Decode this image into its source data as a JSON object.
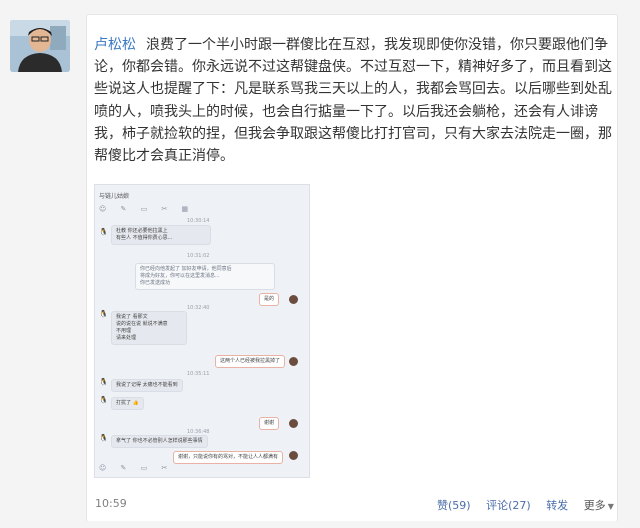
{
  "post": {
    "author": "卢松松",
    "body": "浪费了一个半小时跟一群傻比在互怼，我发现即使你没错，你只要跟他们争论，你都会错。你永远说不过这帮键盘侠。不过互怼一下，精神好多了，而且看到这些说这人也提醒了下：凡是联系骂我三天以上的人，我都会骂回去。以后哪些到处乱喷的人，喷我头上的时候，也会自行掂量一下了。以后我还会躺枪，还会有人诽谤我，柿子就捡软的捏，但我会争取跟这帮傻比打打官司，只有大家去法院走一圈，那帮傻比才会真正消停。",
    "time": "10:59"
  },
  "screenshot": {
    "title": "与链儿姑娘",
    "toolbar_icons": "☺ ✎ ▭ ✂ ▦",
    "bottom_icons": "☺ ✎ ▭ ✂",
    "timestamps": [
      "10:30:14",
      "10:31:02",
      "10:32:40",
      "10:35:11",
      "10:36:48",
      "10:38:20",
      "10:40:02"
    ],
    "messages": [
      "杜教  你还必要他拉黑上\n有些人  不值得你费心思...",
      "你已经向他发起了 加好友申请，他同意后\n将成为好友，你可以在这里发消息...\n你已发送成功",
      "是的",
      "我说了 看那文\n说的说在说 就说不满意\n不用理\n请来处理",
      "这两个人已经被我拉黑掉了",
      "我说了记得  太痛也不能看到",
      "打扰了 👍",
      "谢谢",
      "拿气了  你也不必管别人怎样说那些事情",
      "谢谢，只能说你有的骂对，不能让人人都满有"
    ]
  },
  "actions": {
    "like": "赞(59)",
    "comment": "评论(27)",
    "share": "转发",
    "more": "更多"
  }
}
